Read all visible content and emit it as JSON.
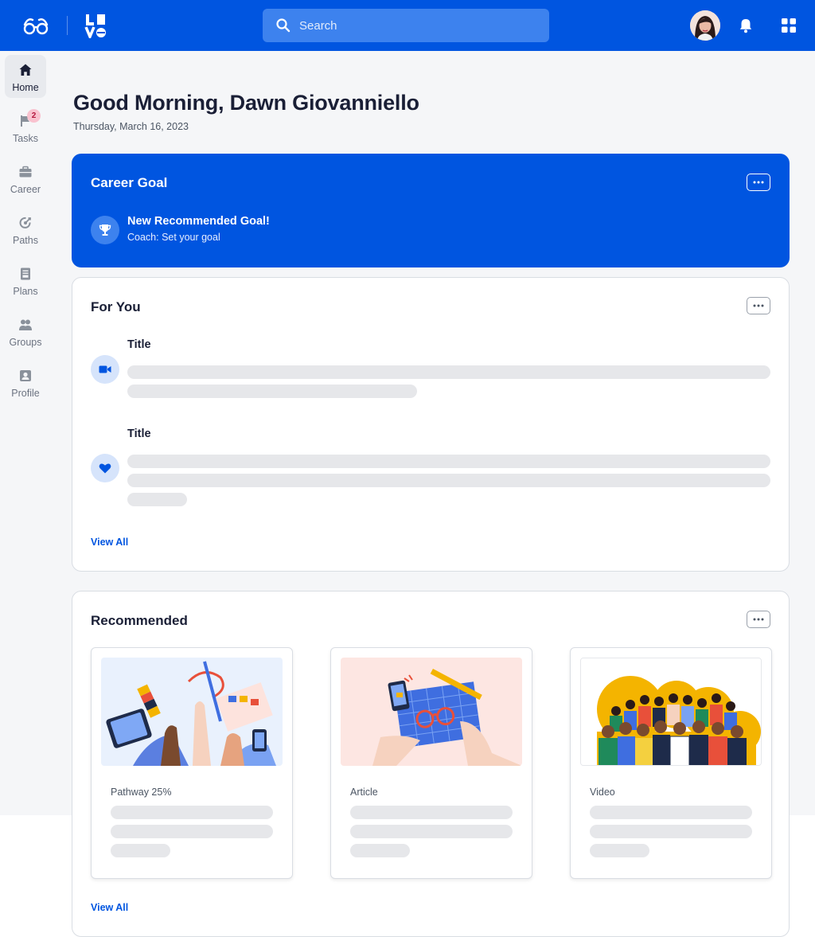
{
  "header": {
    "search_placeholder": "Search"
  },
  "sidebar": {
    "items": [
      {
        "label": "Home"
      },
      {
        "label": "Tasks",
        "badge": "2"
      },
      {
        "label": "Career"
      },
      {
        "label": "Paths"
      },
      {
        "label": "Plans"
      },
      {
        "label": "Groups"
      },
      {
        "label": "Profile"
      }
    ]
  },
  "greeting": {
    "title": "Good Morning, Dawn Giovanniello",
    "date": "Thursday, March 16, 2023"
  },
  "career_goal": {
    "title": "Career Goal",
    "goal_title": "New Recommended Goal!",
    "goal_subtitle": "Coach: Set your goal"
  },
  "for_you": {
    "title": "For You",
    "items": [
      {
        "title": "Title",
        "icon": "video-camera-icon"
      },
      {
        "title": "Title",
        "icon": "heart-icon"
      }
    ],
    "view_all": "View All"
  },
  "recommended": {
    "title": "Recommended",
    "tiles": [
      {
        "label": "Pathway 25%",
        "progress_percent": 25,
        "image": "hands-collaboration-illustration"
      },
      {
        "label": "Article",
        "image": "drawing-glasses-illustration"
      },
      {
        "label": "Video",
        "image": "diverse-crowd-illustration"
      }
    ],
    "view_all": "View All"
  },
  "colors": {
    "brand_blue": "#0055e0",
    "search_bg": "#3d82ee",
    "badge_bg": "#f9c2cf",
    "skeleton": "#e6e7ea",
    "page_gray": "#f5f6f8"
  }
}
